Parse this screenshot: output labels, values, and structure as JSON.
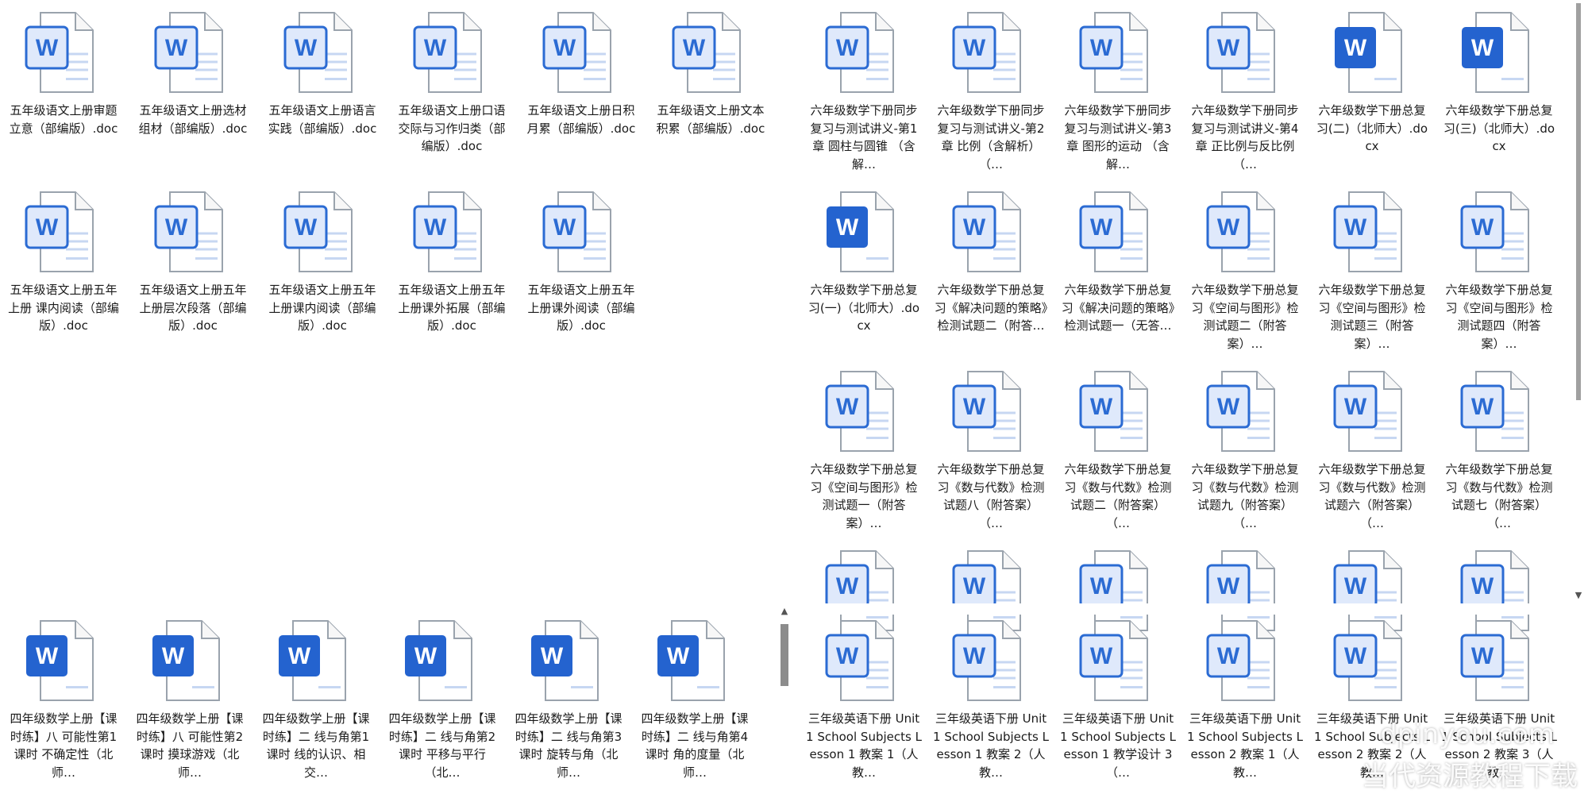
{
  "panes": {
    "top_left": [
      "五年级语文上册审题立意（部编版）.doc",
      "五年级语文上册选材组材（部编版）.doc",
      "五年级语文上册语言实践（部编版）.doc",
      "五年级语文上册口语交际与习作归类（部编版）.doc",
      "五年级语文上册日积月累（部编版）.doc",
      "五年级语文上册文本积累（部编版）.doc",
      "五年级语文上册五年上册 课内阅读（部编版）.doc",
      "五年级语文上册五年上册层次段落（部编版）.doc",
      "五年级语文上册五年上册课内阅读（部编版）.doc",
      "五年级语文上册五年上册课外拓展（部编版）.doc",
      "五年级语文上册五年上册课外阅读（部编版）.doc"
    ],
    "bottom_left": [
      "四年级数学上册【课时练】八 可能性第1课时  不确定性（北师…",
      "四年级数学上册【课时练】八 可能性第2课时  摸球游戏（北师…",
      "四年级数学上册【课时练】二 线与角第1课时  线的认识、相交…",
      "四年级数学上册【课时练】二 线与角第2课时  平移与平行（北…",
      "四年级数学上册【课时练】二 线与角第3课时  旋转与角（北师…",
      "四年级数学上册【课时练】二 线与角第4课时  角的度量（北师…"
    ],
    "right": [
      "六年级数学下册同步复习与测试讲义-第1章 圆柱与圆锥 （含解…",
      "六年级数学下册同步复习与测试讲义-第2章 比例（含解析） （…",
      "六年级数学下册同步复习与测试讲义-第3章 图形的运动 （含解…",
      "六年级数学下册同步复习与测试讲义-第4章 正比例与反比例 （…",
      "六年级数学下册总复习(二)（北师大）.docx",
      "六年级数学下册总复习(三)（北师大）.docx",
      "六年级数学下册总复习(一)（北师大）.docx",
      "六年级数学下册总复习《解决问题的策略》检测试题二（附答…",
      "六年级数学下册总复习《解决问题的策略》检测试题一（无答…",
      "六年级数学下册总复习《空间与图形》检测试题二（附答案）…",
      "六年级数学下册总复习《空间与图形》检测试题三（附答案）…",
      "六年级数学下册总复习《空间与图形》检测试题四（附答案）…",
      "六年级数学下册总复习《空间与图形》检测试题一（附答案）…",
      "六年级数学下册总复习《数与代数》检测试题八（附答案） （…",
      "六年级数学下册总复习《数与代数》检测试题二（附答案） （…",
      "六年级数学下册总复习《数与代数》检测试题九（附答案） （…",
      "六年级数学下册总复习《数与代数》检测试题六（附答案） （…",
      "六年级数学下册总复习《数与代数》检测试题七（附答案） （…",
      "",
      "",
      "",
      "",
      "",
      "",
      "三年级英语下册 Unit 1 School Subjects Lesson 1 教案 1（人教…",
      "三年级英语下册 Unit 1 School Subjects Lesson 1 教案 2（人教…",
      "三年级英语下册 Unit 1 School Subjects Lesson 1 教学设计 3（…",
      "三年级英语下册 Unit 1 School Subjects Lesson 2 教案 1（人教…",
      "三年级英语下册 Unit 1 School Subjects Lesson 2 教案 2（人教…",
      "三年级英语下册 Unit 1 School Subjects Lesson 2 教案 3（人教…"
    ]
  },
  "icon_letter": "W",
  "watermark": {
    "line1": "dpinyou.com",
    "line2": "当代资源教程下载"
  },
  "colors": {
    "word_blue": "#2b6bd3",
    "word_blue_solid": "#2463cf"
  }
}
